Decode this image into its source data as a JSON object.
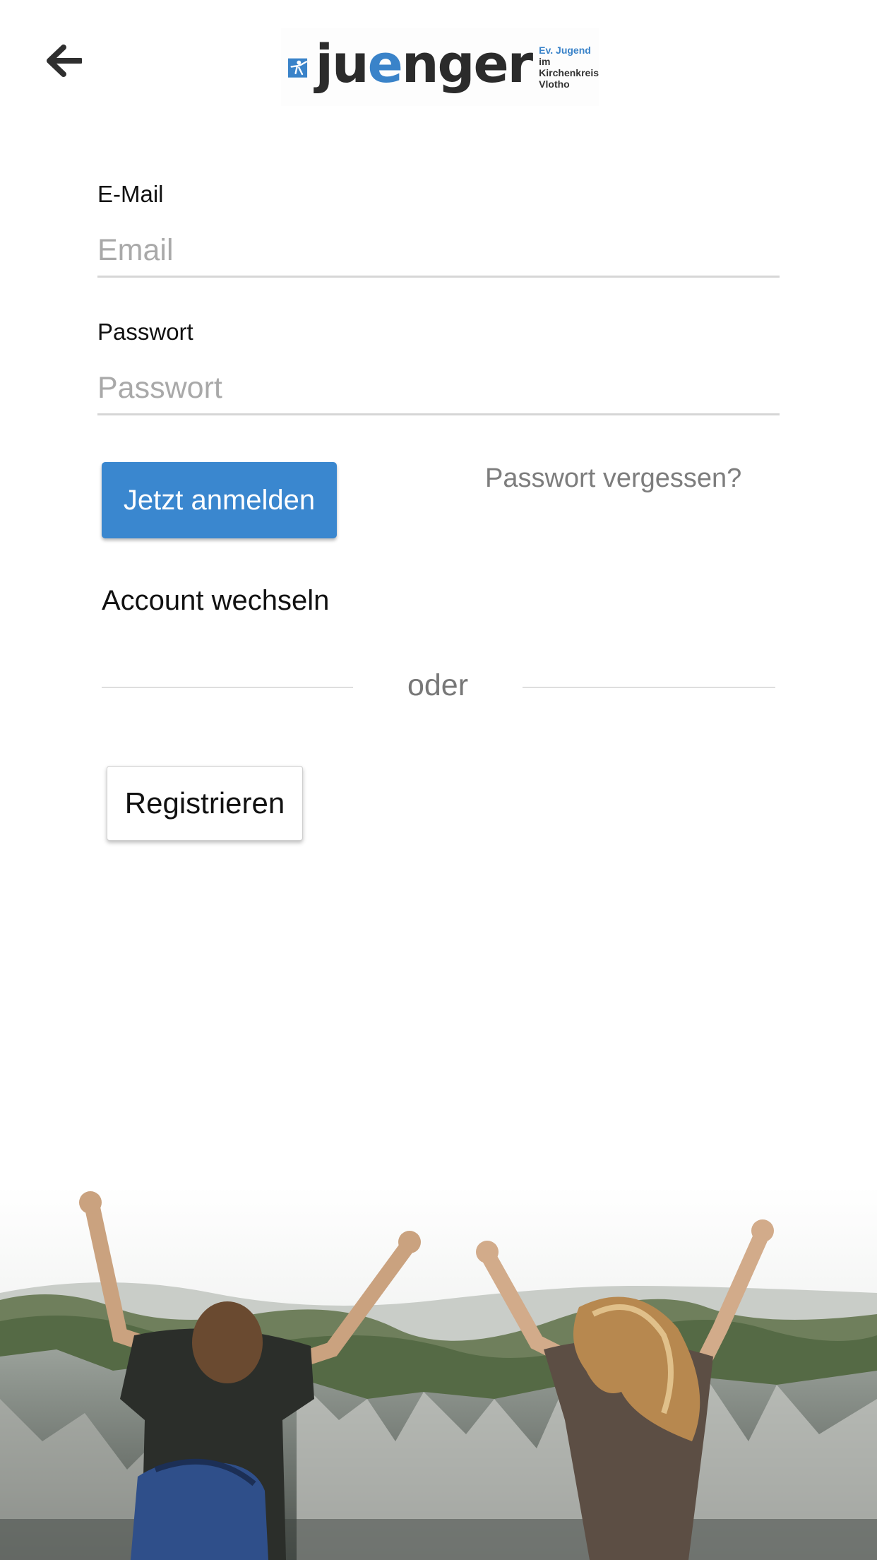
{
  "header": {
    "back_icon": "arrow-left-icon",
    "logo": {
      "word_start": "ju",
      "word_accent": "e",
      "word_end": "nger",
      "tagline_1": "Ev. Jugend",
      "tagline_2": "im Kirchenkreis",
      "tagline_3": "Vlotho",
      "brand_color": "#3a83c9"
    }
  },
  "form": {
    "email": {
      "label": "E-Mail",
      "placeholder": "Email",
      "value": ""
    },
    "password": {
      "label": "Passwort",
      "placeholder": "Passwort",
      "value": ""
    },
    "login_button": "Jetzt anmelden",
    "forgot_link": "Passwort vergessen?",
    "switch_account": "Account wechseln",
    "divider_text": "oder",
    "register_button": "Registrieren"
  },
  "colors": {
    "primary": "#3a87cf",
    "muted_text": "#7d7d7d",
    "placeholder": "#a9a9a9"
  },
  "hero": {
    "subject": "two people cheering on a cliff"
  }
}
